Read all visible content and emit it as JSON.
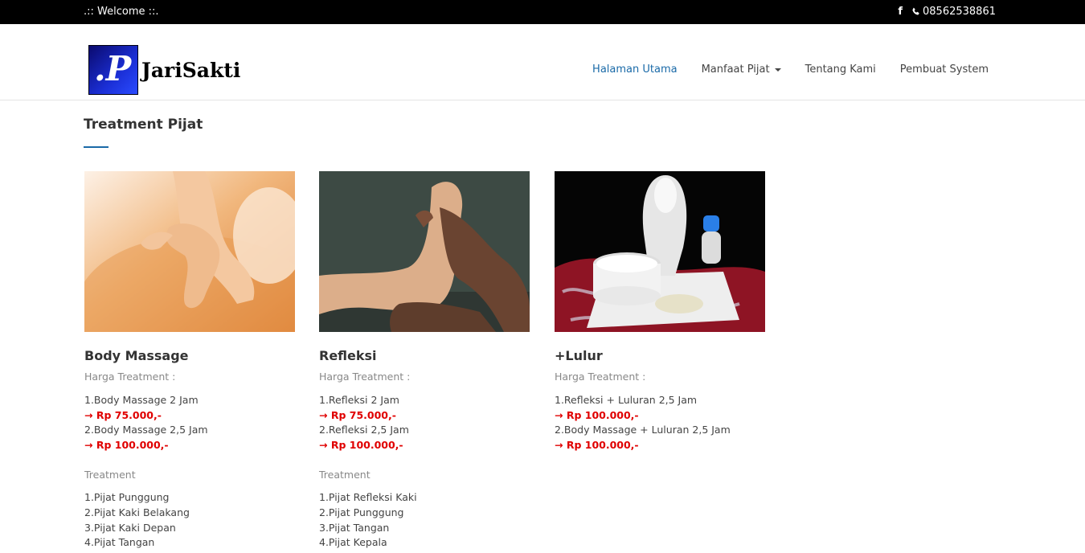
{
  "topbar": {
    "welcome": ".:: Welcome ::.",
    "facebook_icon": "facebook-icon",
    "phone": "08562538861"
  },
  "header": {
    "logo_letter": ".P",
    "logo_text": "JariSakti",
    "nav": [
      {
        "label": "Halaman Utama",
        "active": true
      },
      {
        "label": "Manfaat Pijat",
        "dropdown": true
      },
      {
        "label": "Tentang Kami"
      },
      {
        "label": "Pembuat System"
      }
    ]
  },
  "main": {
    "title": "Treatment Pijat",
    "cards": [
      {
        "name": "Body Massage",
        "price_label": "Harga Treatment :",
        "prices": [
          {
            "item": "1.Body Massage 2 Jam",
            "price": "→ Rp 75.000,-"
          },
          {
            "item": "2.Body Massage 2,5 Jam",
            "price": "→ Rp 100.000,-"
          }
        ],
        "treatment_label": "Treatment",
        "treatments": [
          "1.Pijat Punggung",
          "2.Pijat Kaki Belakang",
          "3.Pijat Kaki Depan",
          "4.Pijat Tangan"
        ]
      },
      {
        "name": "Refleksi",
        "price_label": "Harga Treatment :",
        "prices": [
          {
            "item": "1.Refleksi 2 Jam",
            "price": "→ Rp 75.000,-"
          },
          {
            "item": "2.Refleksi 2,5 Jam",
            "price": "→ Rp 100.000,-"
          }
        ],
        "treatment_label": "Treatment",
        "treatments": [
          "1.Pijat Refleksi Kaki",
          "2.Pijat Punggung",
          "3.Pijat Tangan",
          "4.Pijat Kepala"
        ]
      },
      {
        "name": "+Lulur",
        "price_label": "Harga Treatment :",
        "prices": [
          {
            "item": "1.Refleksi + Luluran 2,5 Jam",
            "price": "→ Rp 100.000,-"
          },
          {
            "item": "2.Body Massage + Luluran 2,5 Jam",
            "price": "→ Rp 100.000,-"
          }
        ]
      }
    ]
  },
  "colors": {
    "accent": "#1a6aa8",
    "price": "#e00000",
    "topbar": "#000000"
  }
}
